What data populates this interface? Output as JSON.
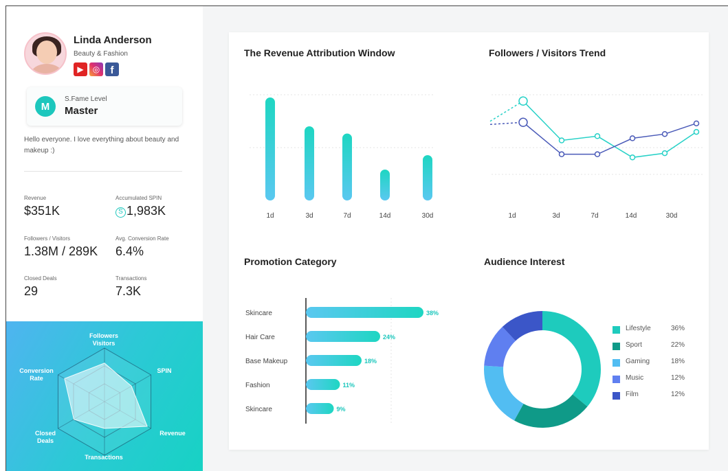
{
  "profile": {
    "name": "Linda Anderson",
    "category": "Beauty & Fashion",
    "socials": [
      {
        "icon": "youtube-icon",
        "glyph": "▶"
      },
      {
        "icon": "instagram-icon",
        "glyph": "◎"
      },
      {
        "icon": "facebook-icon",
        "glyph": "f"
      }
    ],
    "level_badge": "M",
    "level_label": "S.Fame Level",
    "level_value": "Master",
    "bio": "Hello everyone. I love everything about beauty and makeup :)"
  },
  "stats": [
    {
      "label": "Revenue",
      "value": "$351K"
    },
    {
      "label": "Accumulated SPIN",
      "value": "1,983K",
      "icon": "spin-coin-icon",
      "icon_glyph": "S"
    },
    {
      "label": "Followers / Visitors",
      "value": "1.38M / 289K"
    },
    {
      "label": "Avg. Conversion Rate",
      "value": "6.4%"
    },
    {
      "label": "Closed Deals",
      "value": "29"
    },
    {
      "label": "Transactions",
      "value": "7.3K"
    }
  ],
  "radar": {
    "axes": [
      "Followers Visitors",
      "SPIN",
      "Revenue",
      "Transactions",
      "Closed Deals",
      "Conversion Rate"
    ],
    "values": [
      0.72,
      0.58,
      0.92,
      0.5,
      0.66,
      0.86
    ],
    "levels": 3
  },
  "colors": {
    "teal": "#1dc7bd",
    "teal_light": "#26d1c7",
    "navy_line": "#4a5ab8",
    "bar_gradient_start": "#5ac8f0",
    "bar_gradient_end": "#1ed6c2"
  },
  "chart_data": [
    {
      "type": "bar",
      "title": "The Revenue Attribution Window",
      "categories": [
        "1d",
        "3d",
        "7d",
        "14d",
        "30d"
      ],
      "values": [
        100,
        72,
        65,
        30,
        44
      ],
      "ylim": [
        0,
        100
      ]
    },
    {
      "type": "line",
      "title": "Followers / Visitors Trend",
      "categories": [
        "1d",
        "3d",
        "7d",
        "14d",
        "30d"
      ],
      "ylim": [
        0,
        100
      ],
      "series": [
        {
          "values": [
            87,
            50,
            54,
            34,
            38,
            58
          ],
          "color": "#26d1c7",
          "lead_in": 68
        },
        {
          "values": [
            67,
            37,
            37,
            52,
            56,
            66
          ],
          "color": "#4a5ab8",
          "lead_in": 65
        }
      ]
    },
    {
      "type": "bar",
      "orientation": "horizontal",
      "title": "Promotion Category",
      "categories": [
        "Skincare",
        "Hair Care",
        "Base Makeup",
        "Fashion",
        "Skincare"
      ],
      "values": [
        38,
        24,
        18,
        11,
        9
      ],
      "value_labels": [
        "38%",
        "24%",
        "18%",
        "11%",
        "9%"
      ],
      "xlim": [
        0,
        40
      ]
    },
    {
      "type": "pie",
      "title": "Audience Interest",
      "donut": true,
      "categories": [
        "Lifestyle",
        "Sport",
        "Gaming",
        "Music",
        "Film"
      ],
      "values": [
        36,
        22,
        18,
        12,
        12
      ],
      "value_labels": [
        "36%",
        "22%",
        "18%",
        "12%",
        "12%"
      ],
      "colors": [
        "#1ecbbd",
        "#0f9a88",
        "#52bdf2",
        "#5f7ff0",
        "#3b56c8"
      ]
    }
  ]
}
